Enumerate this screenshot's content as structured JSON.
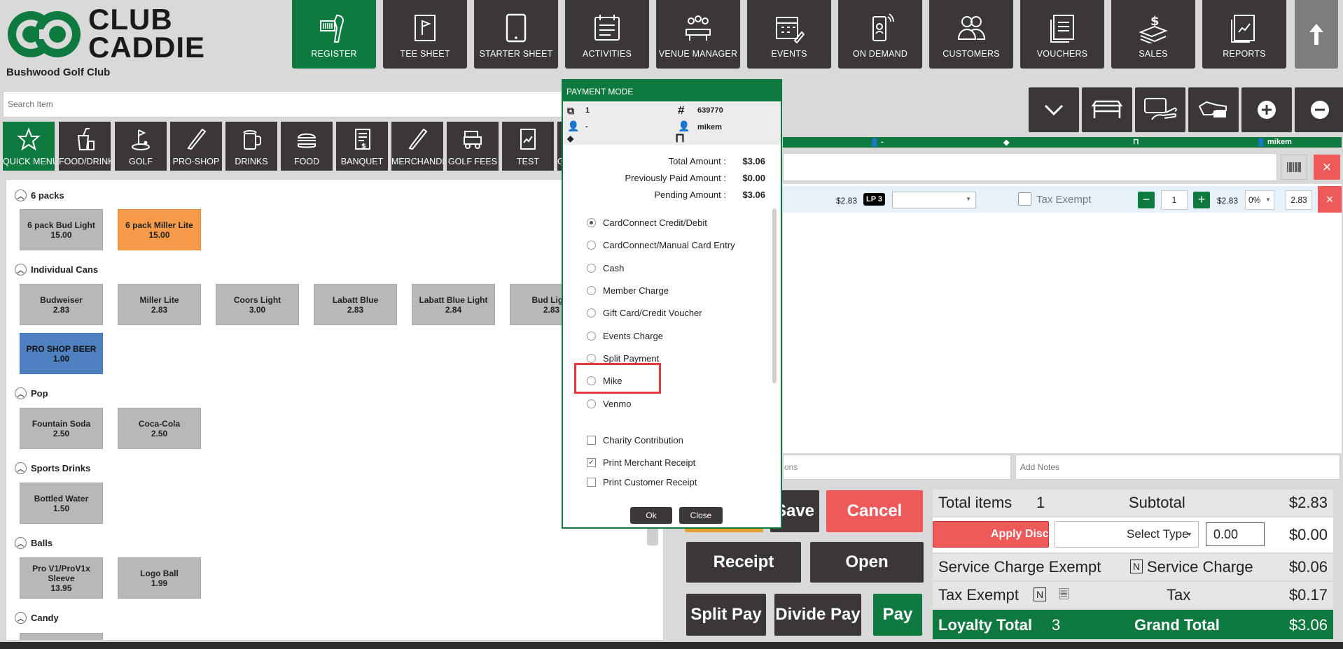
{
  "brand": {
    "logo_line1": "CLUB",
    "logo_line2": "CADDIE",
    "club_name": "Bushwood Golf Club",
    "color_primary": "#0f7a3f",
    "color_dark": "#3b3738",
    "color_danger": "#ee5959"
  },
  "nav": [
    {
      "label": "REGISTER",
      "icon": "register-icon"
    },
    {
      "label": "TEE SHEET",
      "icon": "flag-icon"
    },
    {
      "label": "STARTER SHEET",
      "icon": "tablet-icon"
    },
    {
      "label": "ACTIVITIES",
      "icon": "calendar-list-icon"
    },
    {
      "label": "VENUE MANAGER",
      "icon": "venue-icon"
    },
    {
      "label": "EVENTS",
      "icon": "events-calendar-icon"
    },
    {
      "label": "ON DEMAND",
      "icon": "phone-icon"
    },
    {
      "label": "CUSTOMERS",
      "icon": "people-icon"
    },
    {
      "label": "VOUCHERS",
      "icon": "vouchers-icon"
    },
    {
      "label": "SALES",
      "icon": "money-icon"
    },
    {
      "label": "REPORTS",
      "icon": "report-icon"
    }
  ],
  "search": {
    "placeholder": "Search Item"
  },
  "categories": [
    {
      "label": "QUICK MENU",
      "icon": "star-icon"
    },
    {
      "label": "FOOD/DRINK",
      "icon": "cup-icon"
    },
    {
      "label": "GOLF",
      "icon": "golf-icon"
    },
    {
      "label": "PRO-SHOP",
      "icon": "club-icon"
    },
    {
      "label": "DRINKS",
      "icon": "beer-icon"
    },
    {
      "label": "FOOD",
      "icon": "burger-icon"
    },
    {
      "label": "BANQUET",
      "icon": "banquet-icon"
    },
    {
      "label": "MERCHANDISE",
      "icon": "merch-icon"
    },
    {
      "label": "GOLF FEES",
      "icon": "cart-icon"
    },
    {
      "label": "TEST",
      "icon": "test-icon"
    },
    {
      "label": "G",
      "icon": "more-icon"
    }
  ],
  "sections": [
    {
      "title": "6 packs",
      "items": [
        {
          "name": "6 pack Bud Light",
          "price": "15.00"
        },
        {
          "name": "6 pack Miller Lite",
          "price": "15.00"
        }
      ]
    },
    {
      "title": "Individual Cans",
      "items": [
        {
          "name": "Budweiser",
          "price": "2.83"
        },
        {
          "name": "Miller Lite",
          "price": "2.83"
        },
        {
          "name": "Coors Light",
          "price": "3.00"
        },
        {
          "name": "Labatt Blue",
          "price": "2.83"
        },
        {
          "name": "Labatt Blue Light",
          "price": "2.84"
        },
        {
          "name": "Bud Light",
          "price": "2.83"
        },
        {
          "name": "PRO SHOP BEER",
          "price": "1.00"
        }
      ]
    },
    {
      "title": "Pop",
      "items": [
        {
          "name": "Fountain Soda",
          "price": "2.50"
        },
        {
          "name": "Coca-Cola",
          "price": "2.50"
        }
      ]
    },
    {
      "title": "Sports Drinks",
      "items": [
        {
          "name": "Bottled Water",
          "price": "1.50"
        }
      ]
    },
    {
      "title": "Balls",
      "items": [
        {
          "name": "Pro V1/ProV1x Sleeve",
          "price": "13.95"
        },
        {
          "name": "Logo Ball",
          "price": "1.99"
        }
      ]
    },
    {
      "title": "Candy",
      "items": []
    }
  ],
  "customer_bar": {
    "customer": "-",
    "server": "mikem"
  },
  "cart": {
    "row": {
      "price": "$2.83",
      "badge": "LP 3",
      "tax_exempt_label": "Tax Exempt",
      "qty": "1",
      "line_price": "$2.83",
      "discount": "0%",
      "final": "2.83"
    },
    "notes_left": "ons",
    "notes_placeholder": "Add Notes"
  },
  "actions": {
    "save": "Save",
    "cancel": "Cancel",
    "receipt": "Receipt",
    "open": "Open",
    "split_pay": "Split Pay",
    "divide_pay": "Divide Pay",
    "pay": "Pay"
  },
  "totals": {
    "total_items_label": "Total items",
    "total_items": "1",
    "subtotal_label": "Subtotal",
    "subtotal": "$2.83",
    "apply_discount": "Apply Discount",
    "select_type": "Select Type",
    "discount_value": "0.00",
    "discount_amount": "$0.00",
    "service_exempt_label": "Service Charge Exempt",
    "service_exempt_flag": "N",
    "service_label": "Service Charge",
    "service": "$0.06",
    "tax_exempt_label": "Tax Exempt",
    "tax_exempt_flag": "N",
    "tax_label": "Tax",
    "tax": "$0.17",
    "loyalty_label": "Loyalty Total",
    "loyalty": "3",
    "grand_label": "Grand Total",
    "grand": "$3.06"
  },
  "modal": {
    "title": "PAYMENT MODE",
    "info": {
      "copies": "1",
      "ticket": "639770",
      "customer": "-",
      "user": "mikem"
    },
    "amounts": [
      {
        "label": "Total Amount :",
        "value": "$3.06"
      },
      {
        "label": "Previously Paid Amount :",
        "value": "$0.00"
      },
      {
        "label": "Pending Amount :",
        "value": "$3.06"
      }
    ],
    "methods": [
      "CardConnect Credit/Debit",
      "CardConnect/Manual Card Entry",
      "Cash",
      "Member Charge",
      "Gift Card/Credit Voucher",
      "Events Charge",
      "Split Payment",
      "Mike",
      "Venmo"
    ],
    "selected": "CardConnect Credit/Debit",
    "checks": [
      {
        "label": "Charity Contribution",
        "checked": false
      },
      {
        "label": "Print Merchant Receipt",
        "checked": true
      },
      {
        "label": "Print Customer Receipt",
        "checked": false
      }
    ],
    "ok": "Ok",
    "close": "Close"
  }
}
